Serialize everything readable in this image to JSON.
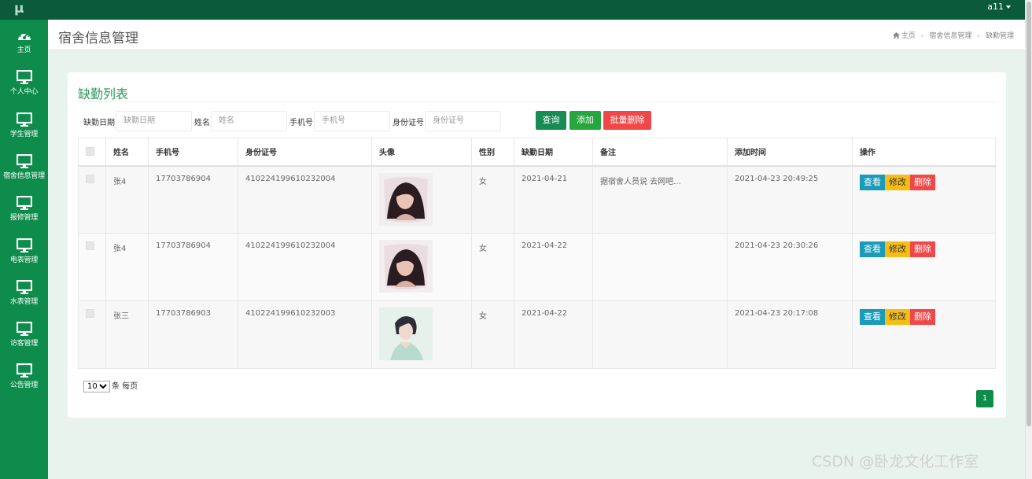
{
  "app": {
    "logo": "μ",
    "user": "a11"
  },
  "sidebar": {
    "items": [
      {
        "label": "主页",
        "icon": "dashboard-icon"
      },
      {
        "label": "个人中心",
        "icon": "monitor-icon"
      },
      {
        "label": "学生管理",
        "icon": "monitor-icon"
      },
      {
        "label": "宿舍信息管理",
        "icon": "monitor-icon"
      },
      {
        "label": "报修管理",
        "icon": "monitor-icon"
      },
      {
        "label": "电表管理",
        "icon": "monitor-icon"
      },
      {
        "label": "水表管理",
        "icon": "monitor-icon"
      },
      {
        "label": "访客管理",
        "icon": "monitor-icon"
      },
      {
        "label": "公告管理",
        "icon": "monitor-icon"
      }
    ]
  },
  "header": {
    "title": "宿舍信息管理",
    "breadcrumb": [
      "主页",
      "宿舍信息管理",
      "缺勤管理"
    ]
  },
  "card": {
    "title": "缺勤列表"
  },
  "search": {
    "fields": [
      {
        "label": "缺勤日期",
        "placeholder": "缺勤日期"
      },
      {
        "label": "姓名",
        "placeholder": "姓名"
      },
      {
        "label": "手机号",
        "placeholder": "手机号"
      },
      {
        "label": "身份证号",
        "placeholder": "身份证号"
      }
    ],
    "query_label": "查询",
    "add_label": "添加",
    "batch_delete_label": "批量删除"
  },
  "table": {
    "columns": [
      "姓名",
      "手机号",
      "身份证号",
      "头像",
      "性别",
      "缺勤日期",
      "备注",
      "添加时间",
      "操作"
    ],
    "rows": [
      {
        "name": "张4",
        "phone": "17703786904",
        "id_card": "410224199610232004",
        "gender": "女",
        "absence_date": "2021-04-21",
        "remark": "据宿舍人员说 去网吧...",
        "added": "2021-04-23 20:49:25"
      },
      {
        "name": "张4",
        "phone": "17703786904",
        "id_card": "410224199610232004",
        "gender": "女",
        "absence_date": "2021-04-22",
        "remark": "",
        "added": "2021-04-23 20:30:26"
      },
      {
        "name": "张三",
        "phone": "17703786903",
        "id_card": "410224199610232003",
        "gender": "女",
        "absence_date": "2021-04-22",
        "remark": "",
        "added": "2021-04-23 20:17:08"
      }
    ],
    "actions": {
      "view": "查看",
      "edit": "修改",
      "delete": "删除"
    }
  },
  "pagination": {
    "page_size": "10",
    "page_size_suffix": "条 每页",
    "current_page": "1"
  },
  "watermark": "CSDN @卧龙文化工作室"
}
